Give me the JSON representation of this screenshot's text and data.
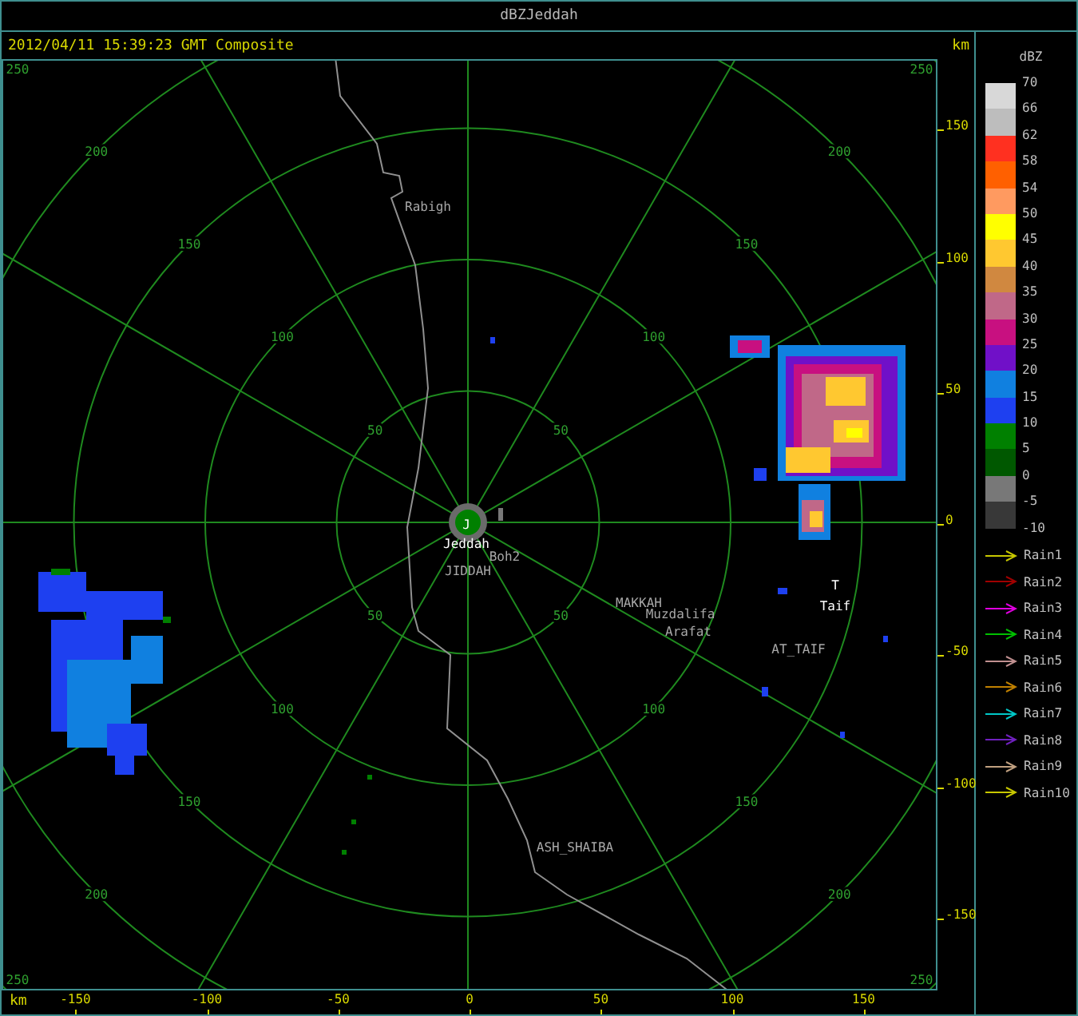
{
  "window": {
    "title": "dBZJeddah"
  },
  "header": {
    "timestamp": "2012/04/11 15:39:23 GMT Composite",
    "unit": "km"
  },
  "plot": {
    "range_rings": [
      {
        "labels": [
          "50",
          "50",
          "50",
          "50"
        ]
      },
      {
        "labels": [
          "100",
          "100",
          "100",
          "100"
        ]
      },
      {
        "labels": [
          "150",
          "150",
          "150",
          "150"
        ]
      },
      {
        "labels": [
          "200",
          "200",
          "200",
          "200"
        ]
      },
      {
        "labels": [
          "250",
          "250",
          "250",
          "250"
        ]
      }
    ],
    "places": [
      "Rabigh",
      "J",
      "Jeddah",
      "JIDDAH",
      "Boh2",
      "MAKKAH",
      "Muzdalifa",
      "Arafat",
      "T",
      "Taif",
      "AT_TAIF",
      "ASH_SHAIBA"
    ]
  },
  "y_axis": {
    "ticks": [
      "150",
      "100",
      "50",
      "0",
      "-50",
      "-100",
      "-150"
    ]
  },
  "x_axis": {
    "unit": "km",
    "ticks": [
      "-150",
      "-100",
      "-50",
      "0",
      "50",
      "100",
      "150"
    ]
  },
  "legend": {
    "title": "dBZ",
    "levels": [
      "70",
      "66",
      "62",
      "58",
      "54",
      "50",
      "45",
      "40",
      "35",
      "30",
      "25",
      "20",
      "15",
      "10",
      "5",
      "0",
      "-5",
      "-10"
    ],
    "bands": [
      {
        "color": "#d8d8d8"
      },
      {
        "color": "#bdbdbd"
      },
      {
        "color": "#ff3020"
      },
      {
        "color": "#ff6000"
      },
      {
        "color": "#ff9a60"
      },
      {
        "color": "#ffff00"
      },
      {
        "color": "#ffc830"
      },
      {
        "color": "#d08840"
      },
      {
        "color": "#c06888"
      },
      {
        "color": "#c81080"
      },
      {
        "color": "#7010c8"
      },
      {
        "color": "#1080e0"
      },
      {
        "color": "#1e40f0"
      },
      {
        "color": "#008000"
      },
      {
        "color": "#005800"
      },
      {
        "color": "#787878"
      },
      {
        "color": "#383838"
      }
    ]
  },
  "tracks": [
    {
      "label": "Rain1",
      "color": "#c8c800"
    },
    {
      "label": "Rain2",
      "color": "#a00000"
    },
    {
      "label": "Rain3",
      "color": "#e000e0"
    },
    {
      "label": "Rain4",
      "color": "#00c000"
    },
    {
      "label": "Rain5",
      "color": "#c09090"
    },
    {
      "label": "Rain6",
      "color": "#c08000"
    },
    {
      "label": "Rain7",
      "color": "#00c8c8"
    },
    {
      "label": "Rain8",
      "color": "#7020c0"
    },
    {
      "label": "Rain9",
      "color": "#c0a080"
    },
    {
      "label": "Rain10",
      "color": "#c8c800"
    }
  ]
}
